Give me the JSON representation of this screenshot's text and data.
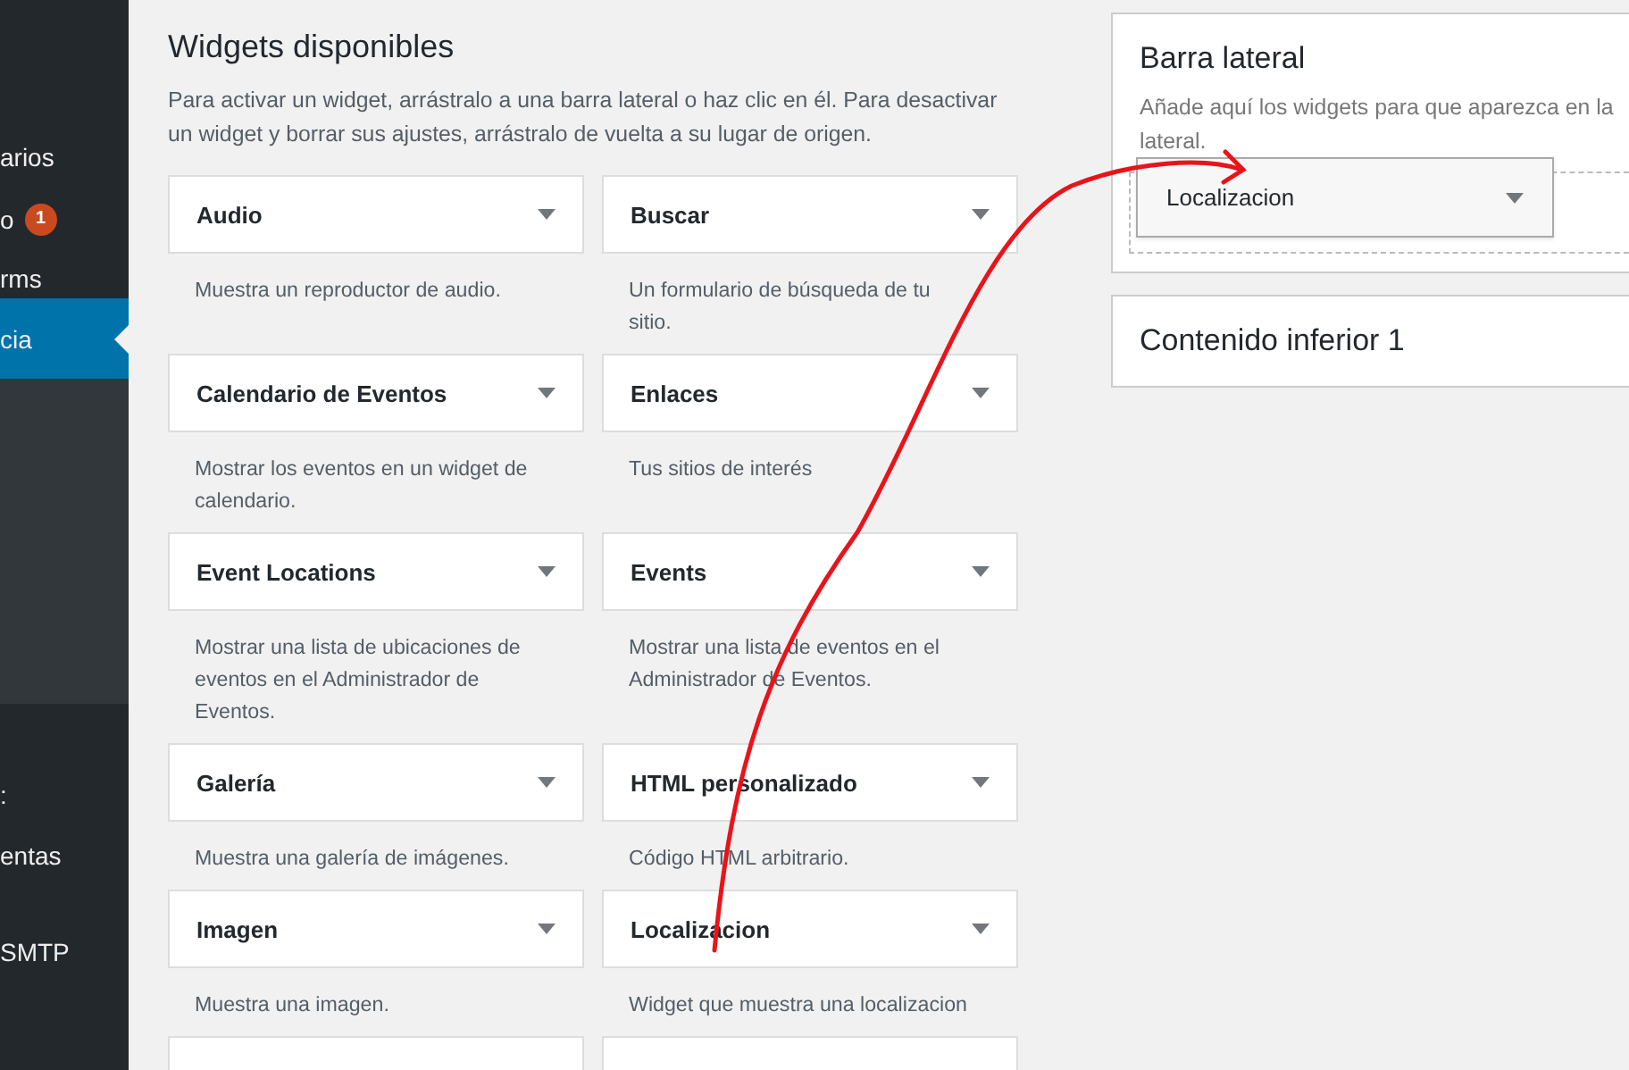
{
  "admin_menu": {
    "items": [
      {
        "label": "arios",
        "selected": false
      },
      {
        "label": "o",
        "selected": false,
        "badge": "1"
      },
      {
        "label": "rms",
        "selected": false
      },
      {
        "label": "cia",
        "selected": true
      },
      {
        "label": ":",
        "selected": false
      },
      {
        "label": "entas",
        "selected": false
      },
      {
        "label": "SMTP",
        "selected": false
      }
    ]
  },
  "available_widgets": {
    "title": "Widgets disponibles",
    "description": "Para activar un widget, arrástralo a una barra lateral o haz clic en él. Para desactivar un widget y borrar sus ajustes, arrástralo de vuelta a su lugar de origen.",
    "widgets": [
      {
        "kind": "widget",
        "name": "Audio",
        "description": "Muestra un reproductor de audio."
      },
      {
        "kind": "widget",
        "name": "Buscar",
        "description": "Un formulario de búsqueda de tu sitio."
      },
      {
        "kind": "widget",
        "name": "Calendario de Eventos",
        "description": "Mostrar los eventos en un widget de calendario."
      },
      {
        "kind": "widget",
        "name": "Enlaces",
        "description": "Tus sitios de interés"
      },
      {
        "kind": "widget",
        "name": "Event Locations",
        "description": "Mostrar una lista de ubicaciones de eventos en el Administrador de Eventos."
      },
      {
        "kind": "widget",
        "name": "Events",
        "description": "Mostrar una lista de eventos en el Administrador de Eventos."
      },
      {
        "kind": "widget",
        "name": "Galería",
        "description": "Muestra una galería de imágenes."
      },
      {
        "kind": "widget",
        "name": "HTML personalizado",
        "description": "Código HTML arbitrario."
      },
      {
        "kind": "widget",
        "name": "Imagen",
        "description": "Muestra una imagen."
      },
      {
        "kind": "widget",
        "name": "Localizacion",
        "description": "Widget que muestra una localizacion"
      },
      {
        "kind": "cut"
      },
      {
        "kind": "cut"
      }
    ]
  },
  "widget_areas": [
    {
      "title": "Barra lateral",
      "description_lines": [
        "Añade aquí los widgets para que aparezca en la",
        "lateral."
      ],
      "expanded": true,
      "dragged_widget": "Localizacion"
    },
    {
      "title": "Contenido inferior 1",
      "expanded": false
    }
  ]
}
